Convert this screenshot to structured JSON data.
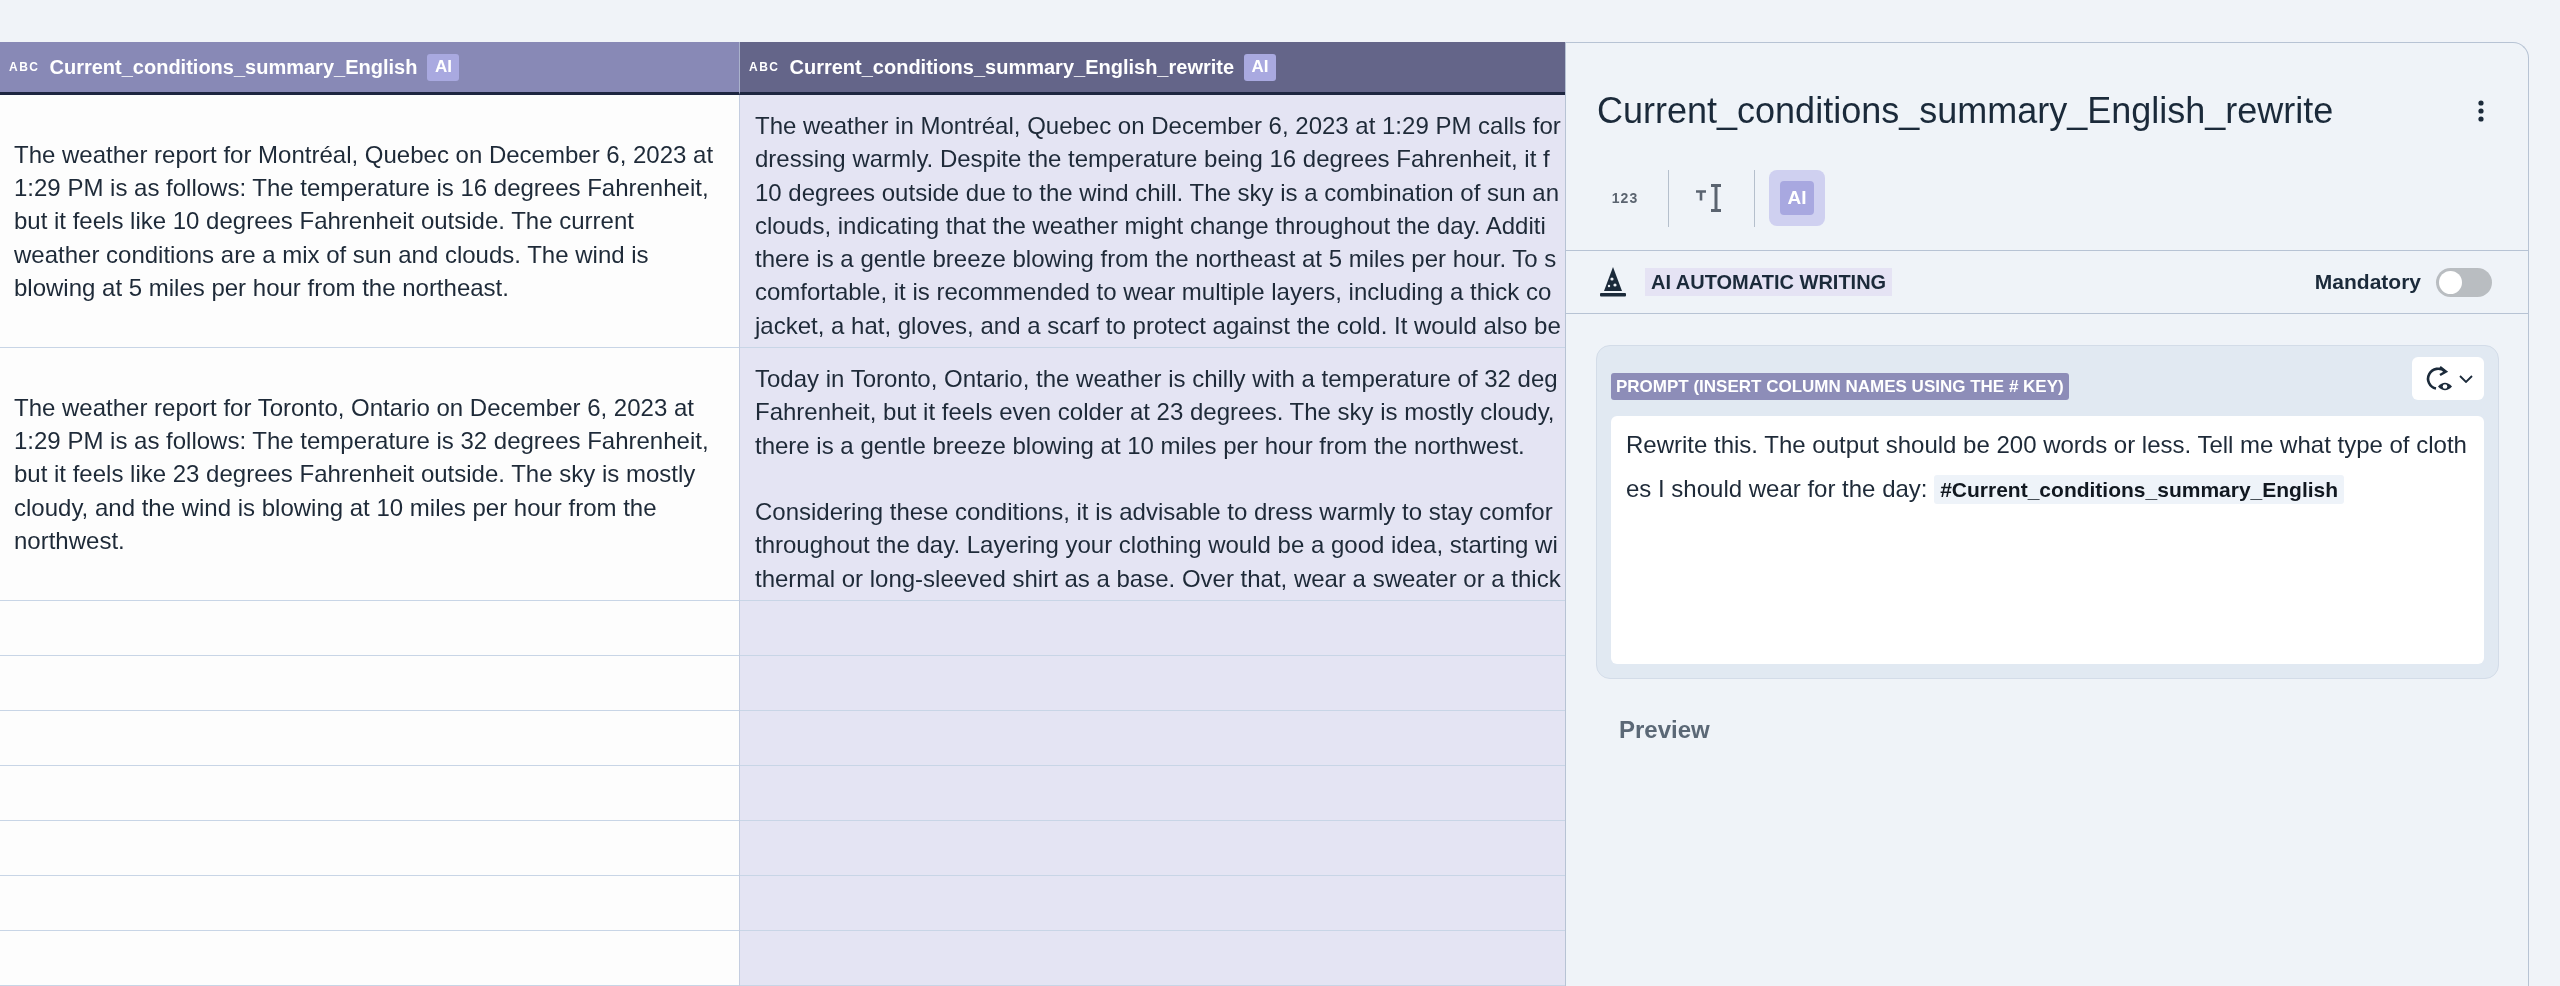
{
  "table": {
    "columns": [
      {
        "type_label": "ABC",
        "title": "Current_conditions_summary_English",
        "ai_badge": "AI",
        "selected": false
      },
      {
        "type_label": "ABC",
        "title": "Current_conditions_summary_English_rewrite",
        "ai_badge": "AI",
        "selected": true
      }
    ],
    "rows": [
      {
        "cells": [
          {
            "kind": "wrapped",
            "text": "The weather report for Montréal, Quebec on December 6, 2023 at 1:29 PM is as follows: The temperature is 16 degrees Fahrenheit, but it feels like 10 degrees Fahrenheit outside. The current weather conditions are a mix of sun and clouds. The wind is blowing at 5 miles per hour from the northeast."
          },
          {
            "kind": "clipped",
            "paragraphs": [
              [
                "The weather in Montréal, Quebec on December 6, 2023 at 1:29 PM calls for",
                "dressing warmly. Despite the temperature being 16 degrees Fahrenheit, it f",
                "10 degrees outside due to the wind chill. The sky is a combination of sun an",
                "clouds, indicating that the weather might change throughout the day. Additi",
                "there is a gentle breeze blowing from the northeast at 5 miles per hour. To s",
                "comfortable, it is recommended to wear multiple layers, including a thick co",
                "jacket, a hat, gloves, and a scarf to protect against the cold. It would also be"
              ]
            ]
          }
        ]
      },
      {
        "cells": [
          {
            "kind": "wrapped",
            "text": "The weather report for Toronto, Ontario on December 6, 2023 at 1:29 PM is as follows: The temperature is 32 degrees Fahrenheit, but it feels like 23 degrees Fahrenheit outside. The sky is mostly cloudy, and the wind is blowing at 10 miles per hour from the northwest."
          },
          {
            "kind": "clipped",
            "paragraphs": [
              [
                "Today in Toronto, Ontario, the weather is chilly with a temperature of 32 deg",
                "Fahrenheit, but it feels even colder at 23 degrees. The sky is mostly cloudy,",
                "there is a gentle breeze blowing at 10 miles per hour from the northwest."
              ],
              [
                "Considering these conditions, it is advisable to dress warmly to stay comfor",
                "throughout the day. Layering your clothing would be a good idea, starting wi",
                "thermal or long-sleeved shirt as a base. Over that, wear a sweater or a thick"
              ]
            ]
          }
        ]
      }
    ]
  },
  "panel": {
    "title": "Current_conditions_summary_English_rewrite",
    "type_options": [
      {
        "kind": "number",
        "label": "123",
        "selected": false
      },
      {
        "kind": "text",
        "selected": false
      },
      {
        "kind": "ai",
        "label": "AI",
        "selected": true
      }
    ],
    "section": {
      "label": "AI AUTOMATIC WRITING"
    },
    "mandatory": {
      "label": "Mandatory",
      "on": false
    },
    "prompt": {
      "label": "PROMPT (INSERT COLUMN NAMES USING THE # KEY)",
      "text": "Rewrite this. The output should be 200 words or less. Tell me what type of clothes I should wear for the day:",
      "mention": "#Current_conditions_summary_English"
    },
    "preview": {
      "label": "Preview"
    }
  }
}
